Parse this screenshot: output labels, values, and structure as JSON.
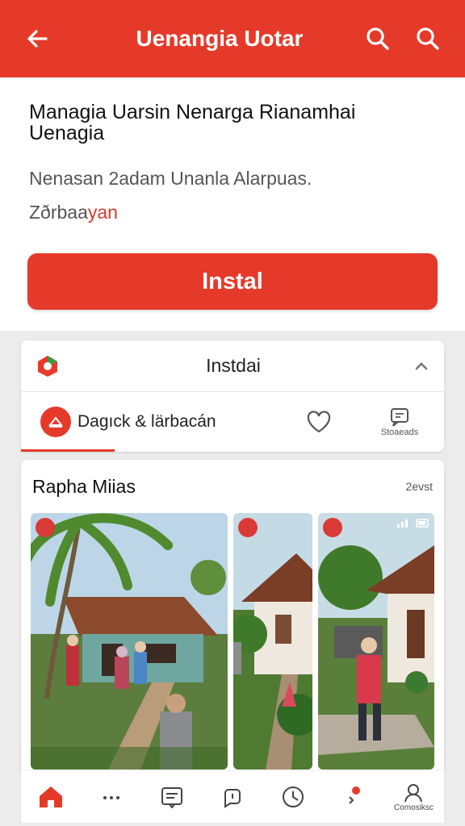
{
  "appbar": {
    "title": "Uenangia Uotar"
  },
  "hero": {
    "title": "Managia Uarsin Nenarga Rianamhai Uenagia",
    "desc_line1": "Nenasan 2adam Unanla Alarpuas.",
    "desc_line2_prefix": "Zðrbaa",
    "desc_line2_accent": "yan",
    "install_label": "Instal"
  },
  "card": {
    "header_label": "Instdai",
    "tab_main_label": "Dagıck & lärbacán",
    "tab_stored_label": "Stoaeads"
  },
  "media": {
    "title": "Rapha Miias",
    "more_label": "2evst"
  },
  "bottom_nav": {
    "profile_label": "Comosiksc"
  },
  "colors": {
    "accent": "#e53a2a",
    "appbar_text": "#ffffff"
  }
}
